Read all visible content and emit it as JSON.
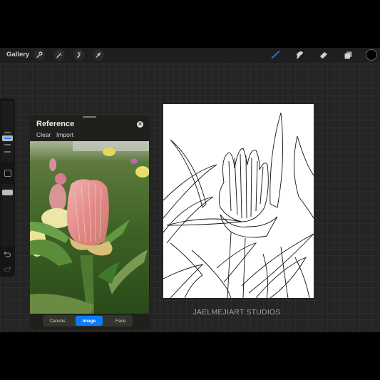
{
  "app": {
    "name": "Procreate"
  },
  "toolbar": {
    "gallery_label": "Gallery",
    "left_tools": [
      {
        "name": "actions",
        "icon": "wrench-icon"
      },
      {
        "name": "adjustments",
        "icon": "magic-wand-icon"
      },
      {
        "name": "selection",
        "icon": "selection-s-icon"
      },
      {
        "name": "transform",
        "icon": "arrow-cursor-icon"
      }
    ],
    "right_tools": [
      {
        "name": "brush",
        "icon": "brush-icon",
        "active": true
      },
      {
        "name": "smudge",
        "icon": "smudge-icon",
        "active": false
      },
      {
        "name": "eraser",
        "icon": "eraser-icon",
        "active": false
      },
      {
        "name": "layers",
        "icon": "layers-icon",
        "active": false
      }
    ],
    "current_color": "#000000",
    "active_tool_color": "#2f7cff"
  },
  "sidebar": {
    "brush_size": 0.38,
    "opacity": 0.9,
    "modify_button": "square-icon",
    "undo": "undo-icon",
    "redo": "redo-icon"
  },
  "reference": {
    "title": "Reference",
    "clear_label": "Clear",
    "import_label": "Import",
    "close_icon": "close-icon",
    "image_description": "Pink ice plant flower bud with green succulent leaves and yellow flowers in background",
    "modes": [
      {
        "label": "Canvas",
        "active": false
      },
      {
        "label": "Image",
        "active": true
      },
      {
        "label": "Face",
        "active": false
      }
    ]
  },
  "canvas": {
    "description": "Black line-art drawing of flower bud with leaves",
    "watermark": "JAELMEJIART STUDIOS"
  },
  "colors": {
    "accent": "#0a7aff",
    "toolbar_bg": "#1e1e1e",
    "workspace_bg": "#242424"
  }
}
